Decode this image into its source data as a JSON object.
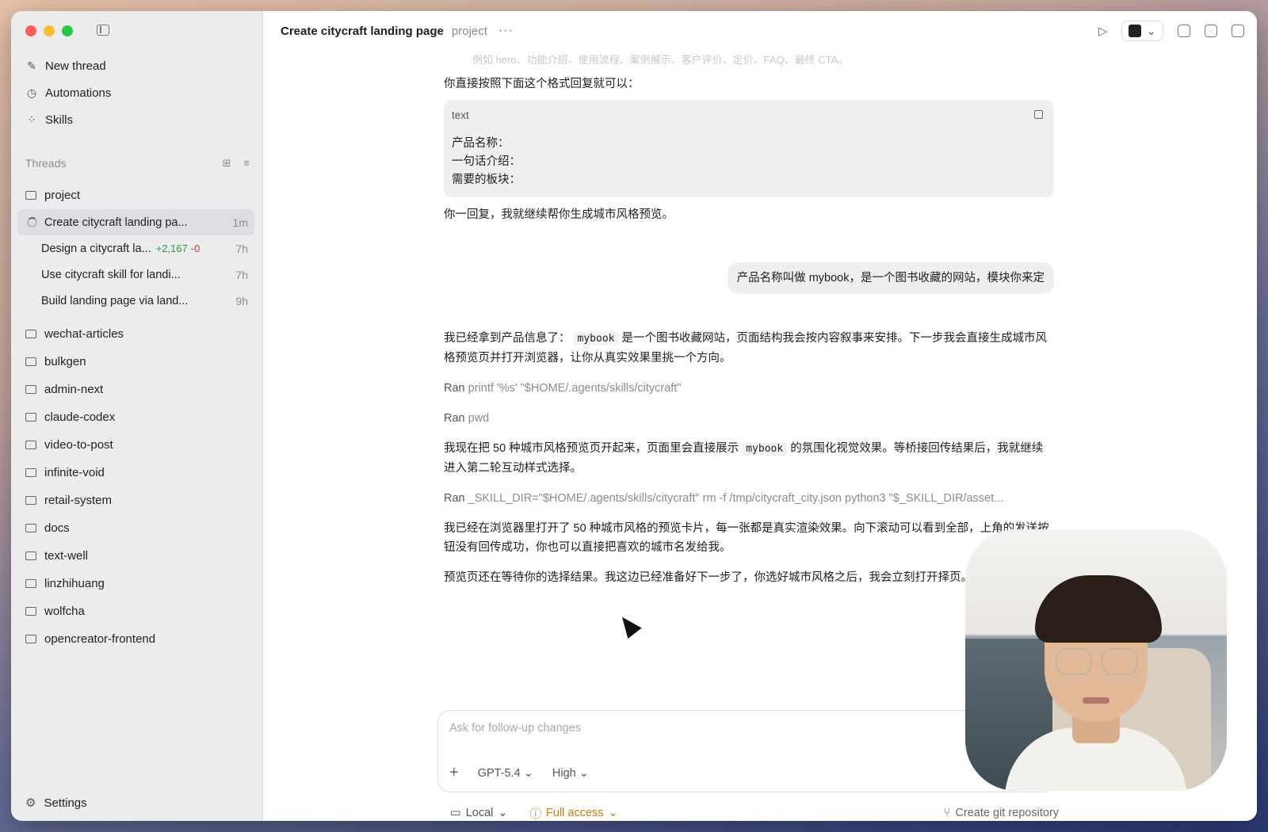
{
  "window": {
    "title": "Create citycraft landing page",
    "project": "project"
  },
  "sidebar": {
    "nav": [
      {
        "label": "New thread",
        "icon": "compose-icon"
      },
      {
        "label": "Automations",
        "icon": "clock-icon"
      },
      {
        "label": "Skills",
        "icon": "grid-icon"
      }
    ],
    "threads_label": "Threads",
    "project_folder": "project",
    "threads": [
      {
        "title": "Create citycraft landing pa...",
        "age": "1m",
        "active": true
      },
      {
        "title": "Design a citycraft la...",
        "added": "+2,167",
        "removed": "-0",
        "age": "7h"
      },
      {
        "title": "Use citycraft skill for landi...",
        "age": "7h"
      },
      {
        "title": "Build landing page via land...",
        "age": "9h"
      }
    ],
    "folders": [
      "wechat-articles",
      "bulkgen",
      "admin-next",
      "claude-codex",
      "video-to-post",
      "infinite-void",
      "retail-system",
      "docs",
      "text-well",
      "linzhihuang",
      "wolfcha",
      "opencreator-frontend"
    ],
    "settings_label": "Settings"
  },
  "chat": {
    "faded_line": "例如 hero、功能介绍、使用流程、案例展示、客户评价、定价、FAQ、最终 CTA。",
    "intro": "你直接按照下面这个格式回复就可以：",
    "code": {
      "lang": "text",
      "lines": [
        "产品名称：",
        "一句话介绍：",
        "需要的板块："
      ]
    },
    "after_code": "你一回复，我就继续帮你生成城市风格预览。",
    "user_message": "产品名称叫做 mybook，是一个图书收藏的网站，模块你来定",
    "reply1_a": "我已经拿到产品信息了：",
    "reply1_code": "mybook",
    "reply1_b": "是一个图书收藏网站，页面结构我会按内容叙事来安排。下一步我会直接生成城市风格预览页并打开浏览器，让你从真实效果里挑一个方向。",
    "ran_label": "Ran",
    "ran1": "printf '%s' \"$HOME/.agents/skills/citycraft\"",
    "ran2": "pwd",
    "reply2_a": "我现在把 50 种城市风格预览页开起来，页面里会直接展示",
    "reply2_code": "mybook",
    "reply2_b": "的氛围化视觉效果。等桥接回传结果后，我就继续进入第二轮互动样式选择。",
    "ran3": "_SKILL_DIR=\"$HOME/.agents/skills/citycraft\" rm -f /tmp/citycraft_city.json python3 \"$_SKILL_DIR/asset...",
    "reply3": "我已经在浏览器里打开了 50 种城市风格的预览卡片，每一张都是真实渲染效果。向下滚动可以看到全部，上角的发送按钮没有回传成功，你也可以直接把喜欢的城市名发给我。",
    "reply4": "预览页还在等待你的选择结果。我这边已经准备好下一步了，你选好城市风格之后，我会立刻打开择页。"
  },
  "composer": {
    "placeholder": "Ask for follow-up changes",
    "model": "GPT-5.4",
    "effort": "High"
  },
  "footer": {
    "local": "Local",
    "access": "Full access",
    "git": "Create git repository"
  },
  "colors": {
    "access": "#d07a12",
    "added": "#2f9a45",
    "removed": "#d23b3b"
  }
}
